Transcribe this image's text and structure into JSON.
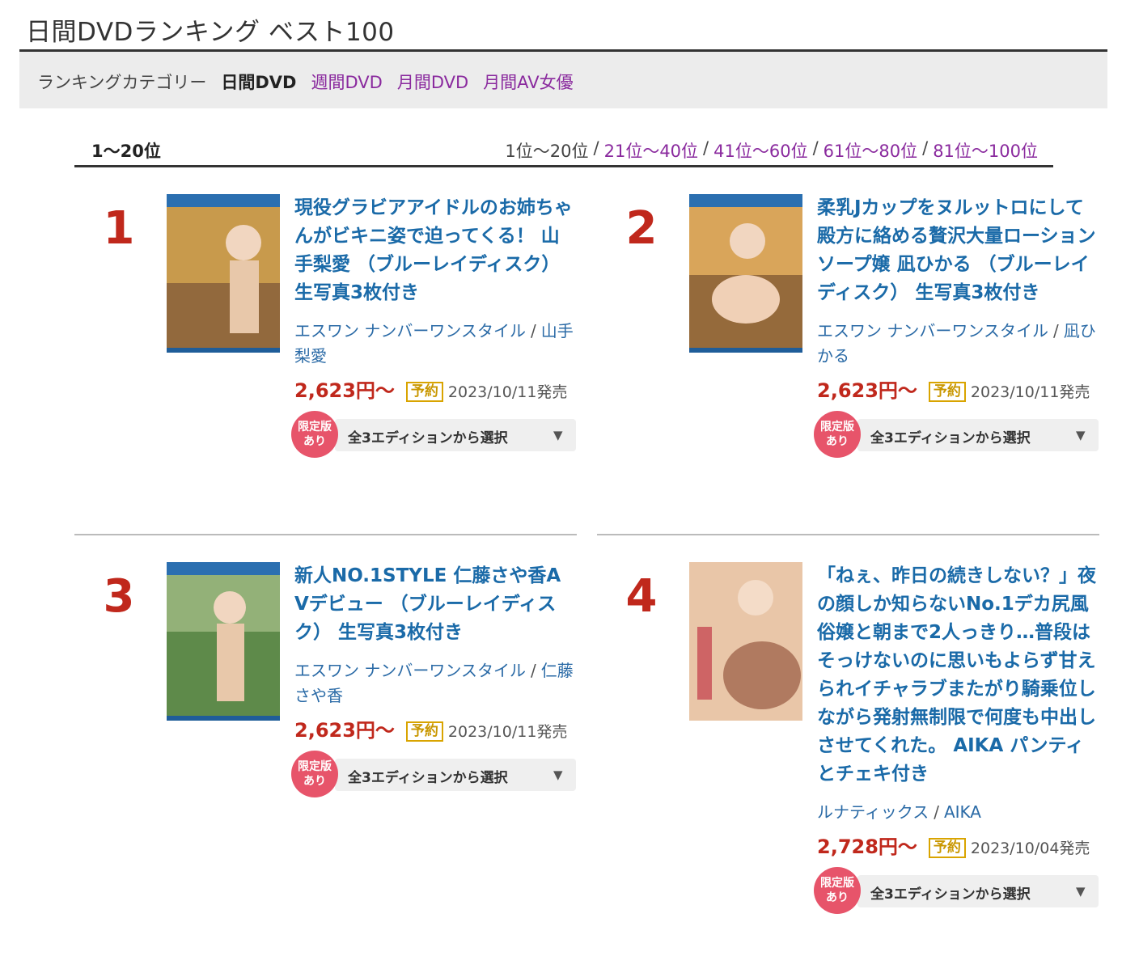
{
  "page": {
    "title": "日間DVDランキング ベスト100"
  },
  "category": {
    "label": "ランキングカテゴリー",
    "current": "日間DVD",
    "links": [
      "週間DVD",
      "月間DVD",
      "月間AV女優"
    ]
  },
  "range": {
    "current": "1〜20位",
    "pages": [
      "1位〜20位",
      "21位〜40位",
      "41位〜60位",
      "61位〜80位",
      "81位〜100位"
    ],
    "separator": "/"
  },
  "items": [
    {
      "rank": "1",
      "title": "現役グラビアアイドルのお姉ちゃんがビキニ姿で迫ってくる！ 山手梨愛 （ブルーレイディスク） 生写真3枚付き",
      "maker": "エスワン ナンバーワンスタイル",
      "actress": "山手梨愛",
      "price": "2,623円〜",
      "badge": "予約",
      "date": "2023/10/11発売",
      "limited": [
        "限定版",
        "あり"
      ],
      "edition": "全3エディションから選択",
      "cover_colors": [
        "#c89a4c",
        "#6e4a34"
      ]
    },
    {
      "rank": "2",
      "title": "柔乳Jカップをヌルットロにして殿方に絡める贅沢大量ローションソープ嬢 凪ひかる （ブルーレイディスク） 生写真3枚付き",
      "maker": "エスワン ナンバーワンスタイル",
      "actress": "凪ひかる",
      "price": "2,623円〜",
      "badge": "予約",
      "date": "2023/10/11発売",
      "limited": [
        "限定版",
        "あり"
      ],
      "edition": "全3エディションから選択",
      "cover_colors": [
        "#d9a55a",
        "#5c3a22"
      ]
    },
    {
      "rank": "3",
      "title": "新人NO.1STYLE 仁藤さや香AVデビュー （ブルーレイディスク） 生写真3枚付き",
      "maker": "エスワン ナンバーワンスタイル",
      "actress": "仁藤さや香",
      "price": "2,623円〜",
      "badge": "予約",
      "date": "2023/10/11発売",
      "limited": [
        "限定版",
        "あり"
      ],
      "edition": "全3エディションから選択",
      "cover_colors": [
        "#5e8a4a",
        "#c7d8a6"
      ]
    },
    {
      "rank": "4",
      "title": "「ねぇ、昨日の続きしない？」夜の顔しか知らないNo.1デカ尻風俗嬢と朝まで2人っきり…普段はそっけないのに思いもよらず甘えられイチャラブまたがり騎乗位しながら発射無制限で何度も中出しさせてくれた。 AIKA パンティとチェキ付き",
      "maker": "ルナティックス",
      "actress": "AIKA",
      "price": "2,728円〜",
      "badge": "予約",
      "date": "2023/10/04発売",
      "limited": [
        "限定版",
        "あり"
      ],
      "edition": "全3エディションから選択",
      "cover_colors": [
        "#e9c6a8",
        "#b07a60"
      ]
    }
  ]
}
